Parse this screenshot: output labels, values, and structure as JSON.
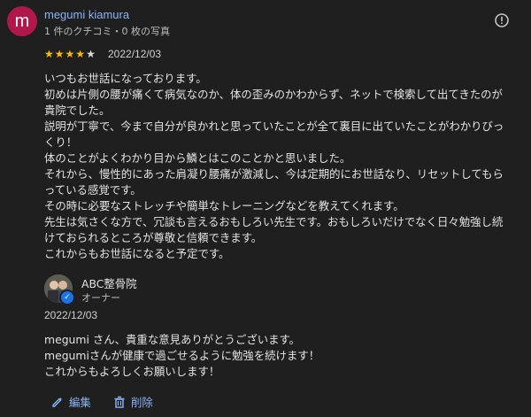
{
  "reviewer": {
    "avatar_letter": "m",
    "name": "megumi kiamura",
    "meta": "1 件のクチコミ・0 枚の写真",
    "rating": 4,
    "rating_max": 5,
    "date": "2022/12/03"
  },
  "review_lines": [
    "いつもお世話になっております。",
    "初めは片側の腰が痛くて病気なのか、体の歪みのかわからず、ネットで検索して出てきたのが",
    "貴院でした。",
    "説明が丁寧で、今まで自分が良かれと思っていたことが全て裏目に出ていたことがわかりびっ",
    "くり！",
    "体のことがよくわかり目から鱗とはこのことかと思いました。",
    "それから、慢性的にあった肩凝り腰痛が激減し、今は定期的にお世話なり、リセットしてもら",
    "っている感覚です。",
    "その時に必要なストレッチや簡単なトレーニングなどを教えてくれます。",
    "先生は気さくな方で、冗談も言えるおもしろい先生です。おもしろいだけでなく日々勉強し続",
    "けておられるところが尊敬と信頼できます。",
    "これからもお世話になると予定です。"
  ],
  "owner": {
    "name": "ABC整骨院",
    "role": "オーナー",
    "date": "2022/12/03"
  },
  "reply_lines": [
    "megumi さん、貴重な意見ありがとうございます。",
    "megumiさんが健康で過ごせるように勉強を続けます！",
    "これからもよろしくお願いします！"
  ],
  "actions": {
    "edit_label": "編集",
    "delete_label": "削除"
  },
  "colors": {
    "background": "#1f1f1f",
    "link": "#8ab4f8",
    "star": "#fbbc04",
    "avatar": "#b0174a",
    "badge": "#1a73e8"
  },
  "icons": [
    "flag-icon",
    "star-icon",
    "verified-badge-icon",
    "pencil-icon",
    "trash-icon"
  ]
}
